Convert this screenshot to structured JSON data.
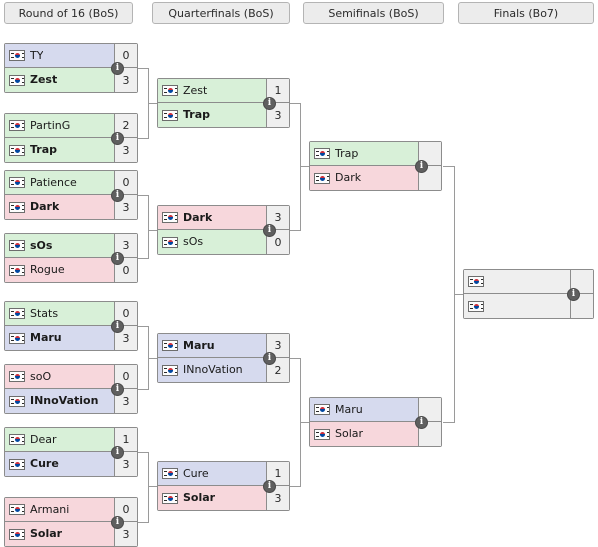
{
  "colors": {
    "protoss": "#d8f0d8",
    "zerg": "#f7d7dc",
    "terran": "#d6daee",
    "empty": "#efefef",
    "border": "#8c8c8c",
    "connector": "#9a9a9a",
    "header_bg": "#ececec"
  },
  "rounds": [
    {
      "label": "Round of 16 (BoS)"
    },
    {
      "label": "Quarterfinals (BoS)"
    },
    {
      "label": "Semifinals (BoS)"
    },
    {
      "label": "Finals (Bo7)"
    }
  ],
  "info_badge_glyph": "i",
  "flag_name": "south-korea-flag",
  "matches": {
    "r16": [
      {
        "top": {
          "name": "TY",
          "score": "0",
          "race": "terran",
          "winner": false
        },
        "bottom": {
          "name": "Zest",
          "score": "3",
          "race": "protoss",
          "winner": true
        }
      },
      {
        "top": {
          "name": "PartinG",
          "score": "2",
          "race": "protoss",
          "winner": false
        },
        "bottom": {
          "name": "Trap",
          "score": "3",
          "race": "protoss",
          "winner": true
        }
      },
      {
        "top": {
          "name": "Patience",
          "score": "0",
          "race": "protoss",
          "winner": false
        },
        "bottom": {
          "name": "Dark",
          "score": "3",
          "race": "zerg",
          "winner": true
        }
      },
      {
        "top": {
          "name": "sOs",
          "score": "3",
          "race": "protoss",
          "winner": true
        },
        "bottom": {
          "name": "Rogue",
          "score": "0",
          "race": "zerg",
          "winner": false
        }
      },
      {
        "top": {
          "name": "Stats",
          "score": "0",
          "race": "protoss",
          "winner": false
        },
        "bottom": {
          "name": "Maru",
          "score": "3",
          "race": "terran",
          "winner": true
        }
      },
      {
        "top": {
          "name": "soO",
          "score": "0",
          "race": "zerg",
          "winner": false
        },
        "bottom": {
          "name": "INnoVation",
          "score": "3",
          "race": "terran",
          "winner": true
        }
      },
      {
        "top": {
          "name": "Dear",
          "score": "1",
          "race": "protoss",
          "winner": false
        },
        "bottom": {
          "name": "Cure",
          "score": "3",
          "race": "terran",
          "winner": true
        }
      },
      {
        "top": {
          "name": "Armani",
          "score": "0",
          "race": "zerg",
          "winner": false
        },
        "bottom": {
          "name": "Solar",
          "score": "3",
          "race": "zerg",
          "winner": true
        }
      }
    ],
    "qf": [
      {
        "top": {
          "name": "Zest",
          "score": "1",
          "race": "protoss",
          "winner": false
        },
        "bottom": {
          "name": "Trap",
          "score": "3",
          "race": "protoss",
          "winner": true
        }
      },
      {
        "top": {
          "name": "Dark",
          "score": "3",
          "race": "zerg",
          "winner": true
        },
        "bottom": {
          "name": "sOs",
          "score": "0",
          "race": "protoss",
          "winner": false
        }
      },
      {
        "top": {
          "name": "Maru",
          "score": "3",
          "race": "terran",
          "winner": true
        },
        "bottom": {
          "name": "INnoVation",
          "score": "2",
          "race": "terran",
          "winner": false
        }
      },
      {
        "top": {
          "name": "Cure",
          "score": "1",
          "race": "terran",
          "winner": false
        },
        "bottom": {
          "name": "Solar",
          "score": "3",
          "race": "zerg",
          "winner": true
        }
      }
    ],
    "sf": [
      {
        "top": {
          "name": "Trap",
          "score": "",
          "race": "protoss",
          "winner": false
        },
        "bottom": {
          "name": "Dark",
          "score": "",
          "race": "zerg",
          "winner": false
        }
      },
      {
        "top": {
          "name": "Maru",
          "score": "",
          "race": "terran",
          "winner": false
        },
        "bottom": {
          "name": "Solar",
          "score": "",
          "race": "zerg",
          "winner": false
        }
      }
    ],
    "final": [
      {
        "top": {
          "name": "",
          "score": "",
          "race": "none",
          "winner": false
        },
        "bottom": {
          "name": "",
          "score": "",
          "race": "none",
          "winner": false
        }
      }
    ]
  }
}
